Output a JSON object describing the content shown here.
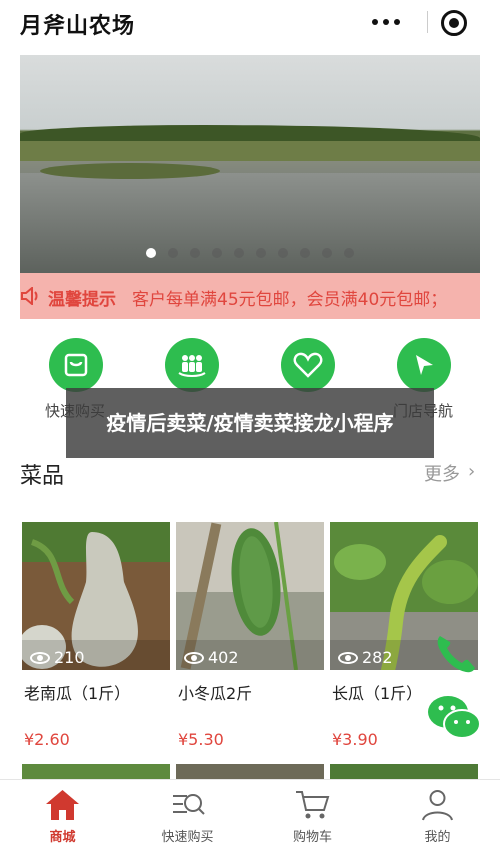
{
  "header": {
    "title": "月斧山农场",
    "more_icon": "more-dots-icon",
    "close_icon": "target-close-icon"
  },
  "banner": {
    "slide_count": 10,
    "active_slide": 1
  },
  "notice": {
    "label": "温馨提示",
    "text": "客户每单满45元包邮，会员满40元包邮；",
    "color": "#e0463e",
    "background": "#f5b3ad"
  },
  "quicknav": [
    {
      "label": "快速购买",
      "icon": "bag-icon"
    },
    {
      "label": "",
      "icon": "group-icon"
    },
    {
      "label": "",
      "icon": "heart-icon"
    },
    {
      "label": "门店导航",
      "icon": "location-arrow-icon"
    }
  ],
  "quicknav_prefix": "快速",
  "quicknav_suffix": "门店导航",
  "overlay": {
    "text": "疫情后卖菜/疫情卖菜接龙小程序"
  },
  "section": {
    "title": "菜品",
    "more": "更多",
    "chevron": "›"
  },
  "products": [
    {
      "name": "老南瓜（1斤）",
      "price": "¥2.60",
      "views": "210"
    },
    {
      "name": "小冬瓜2斤",
      "price": "¥5.30",
      "views": "402"
    },
    {
      "name": "长瓜（1斤）",
      "price": "¥3.90",
      "views": "282"
    }
  ],
  "tabs": [
    {
      "label": "商城",
      "icon": "home-icon",
      "active": true
    },
    {
      "label": "快速购买",
      "icon": "quick-buy-icon",
      "active": false
    },
    {
      "label": "购物车",
      "icon": "cart-icon",
      "active": false
    },
    {
      "label": "我的",
      "icon": "user-icon",
      "active": false
    }
  ],
  "colors": {
    "brand_green": "#2ebd4f",
    "price_red": "#e0463e",
    "active_tab": "#d0392f"
  }
}
